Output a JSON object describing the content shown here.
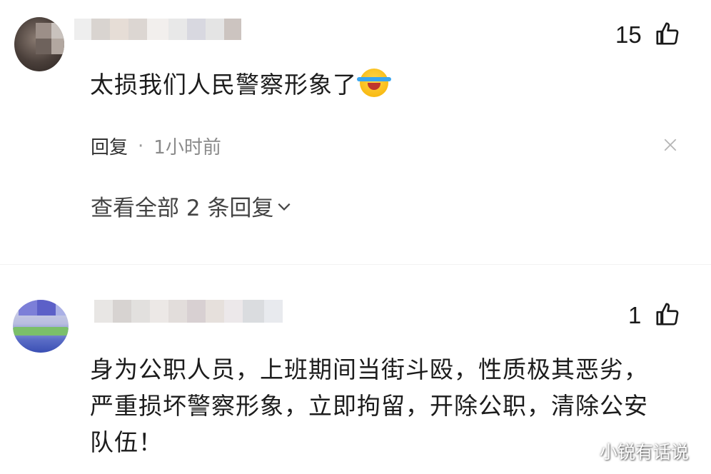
{
  "comments": [
    {
      "text": "太损我们人民警察形象了",
      "emoji_icon": "laughing-crying-emoji",
      "likes": "15",
      "reply_label": "回复",
      "separator": "·",
      "time": "1小时前",
      "view_replies_label": "查看全部 2 条回复"
    },
    {
      "text_lines": [
        "身为公职人员，上班期间当街斗殴，性质极其恶劣，",
        "严重损坏警察形象，立即拘留，开除公职，清除公安",
        "队伍！"
      ],
      "likes": "1"
    }
  ],
  "watermark": "小锐有话说",
  "colors": {
    "text": "#1c1c1c",
    "meta": "#8a8a8a",
    "background": "#ffffff"
  }
}
